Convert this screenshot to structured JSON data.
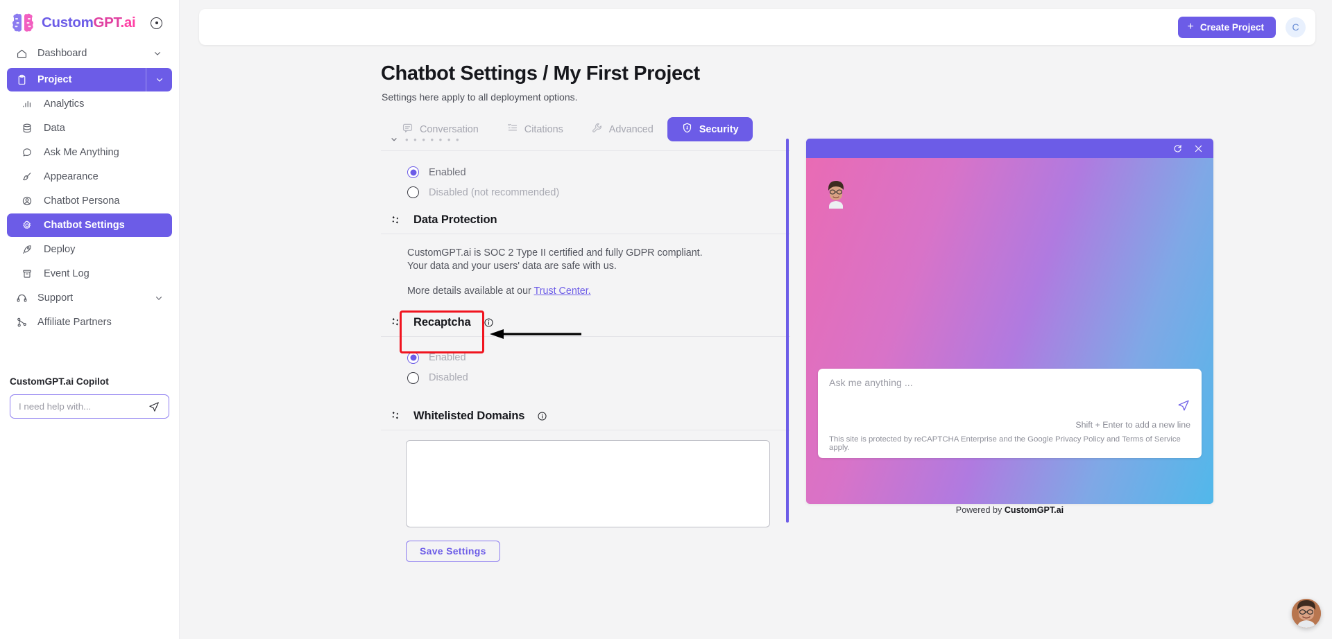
{
  "brand": {
    "part1": "Custom",
    "part2": "GPT",
    "part3": ".ai"
  },
  "sidebar": {
    "items": [
      {
        "label": "Dashboard",
        "icon": "home-icon",
        "chevron": true
      },
      {
        "label": "Project",
        "icon": "clipboard-icon",
        "chevron": true
      },
      {
        "label": "Analytics",
        "icon": "bar-chart-icon"
      },
      {
        "label": "Data",
        "icon": "database-icon"
      },
      {
        "label": "Ask Me Anything",
        "icon": "chat-bubble-icon"
      },
      {
        "label": "Appearance",
        "icon": "paint-brush-icon"
      },
      {
        "label": "Chatbot Persona",
        "icon": "user-circle-icon"
      },
      {
        "label": "Chatbot Settings",
        "icon": "gear-icon"
      },
      {
        "label": "Deploy",
        "icon": "rocket-icon"
      },
      {
        "label": "Event Log",
        "icon": "archive-icon"
      },
      {
        "label": "Support",
        "icon": "headset-icon",
        "chevron": true
      },
      {
        "label": "Affiliate Partners",
        "icon": "share-nodes-icon"
      }
    ],
    "copilot": {
      "title": "CustomGPT.ai Copilot",
      "placeholder": "I need help with...",
      "send_icon": "send-icon"
    }
  },
  "topbar": {
    "create_label": "Create Project",
    "plus": "+",
    "avatar_initial": "C"
  },
  "header": {
    "title": "Chatbot Settings / My First Project",
    "subtitle": "Settings here apply to all deployment options."
  },
  "tabs": [
    {
      "label": "Conversation",
      "icon": "message-icon",
      "active": false
    },
    {
      "label": "Citations",
      "icon": "quote-list-icon",
      "active": false
    },
    {
      "label": "Advanced",
      "icon": "wrench-icon",
      "active": false
    },
    {
      "label": "Security",
      "icon": "shield-icon",
      "active": true
    }
  ],
  "settings": {
    "collapsed_section_dots": "• • • • • • •",
    "top_radio": {
      "enabled_label": "Enabled",
      "disabled_label": "Disabled (not recommended)",
      "selected": "Enabled"
    },
    "data_protection": {
      "title": "Data Protection",
      "line1": "CustomGPT.ai is SOC 2 Type II certified and fully GDPR compliant.",
      "line2": "Your data and your users' data are safe with us.",
      "more_prefix": "More details available at our ",
      "link_label": "Trust Center."
    },
    "recaptcha": {
      "title": "Recaptcha",
      "enabled_label": "Enabled",
      "disabled_label": "Disabled",
      "selected": "Enabled"
    },
    "whitelisted_domains": {
      "title": "Whitelisted Domains",
      "value": "",
      "placeholder": ""
    },
    "save_label": "Save Settings"
  },
  "chat_preview": {
    "refresh_icon": "refresh-icon",
    "close_icon": "close-icon",
    "input_placeholder": "Ask me anything ...",
    "send_icon": "send-icon",
    "hint": "Shift + Enter to add a new line",
    "recaptcha_notice": "This site is protected by reCAPTCHA Enterprise and the Google Privacy Policy and Terms of Service apply.",
    "powered_prefix": "Powered by ",
    "powered_brand": "CustomGPT.ai"
  },
  "colors": {
    "brand_purple": "#6c5ce7",
    "highlight_red": "#f0141f",
    "link": "#6c5ce7"
  }
}
